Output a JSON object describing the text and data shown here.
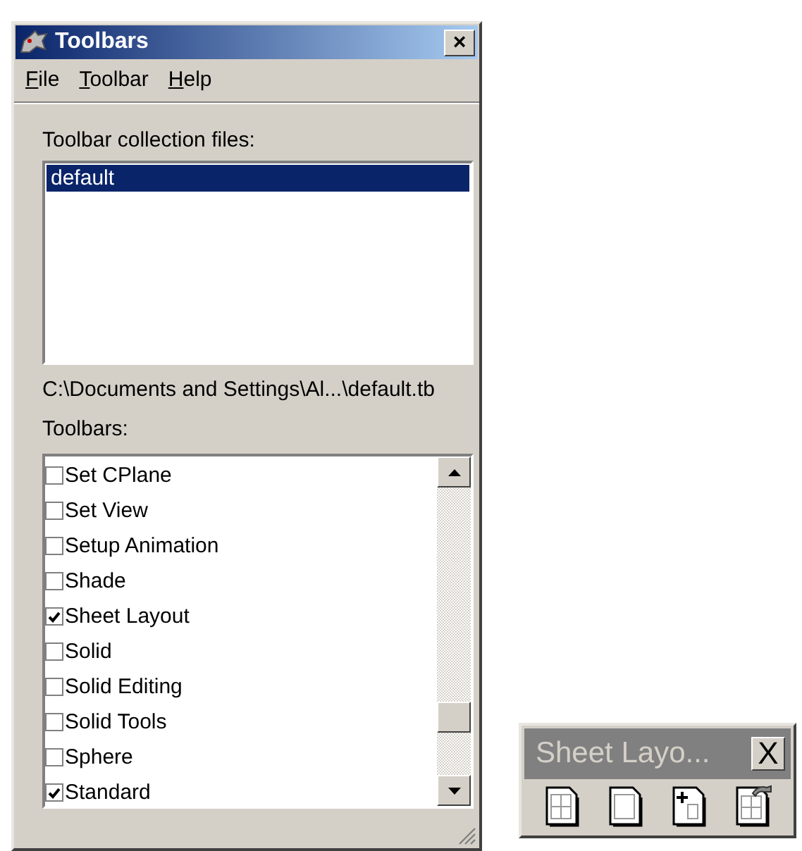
{
  "window": {
    "title": "Toolbars",
    "close": "×"
  },
  "menu": [
    {
      "label": "File"
    },
    {
      "label": "Toolbar"
    },
    {
      "label": "Help"
    }
  ],
  "collection_label": "Toolbar collection files:",
  "collection_files": [
    {
      "label": "default",
      "selected": true
    }
  ],
  "path": "C:\\Documents and Settings\\Al...\\default.tb",
  "toolbars_label": "Toolbars:",
  "toolbars": [
    {
      "label": "Set CPlane",
      "checked": false
    },
    {
      "label": "Set View",
      "checked": false
    },
    {
      "label": "Setup Animation",
      "checked": false
    },
    {
      "label": "Shade",
      "checked": false
    },
    {
      "label": "Sheet Layout",
      "checked": true
    },
    {
      "label": "Solid",
      "checked": false
    },
    {
      "label": "Solid Editing",
      "checked": false
    },
    {
      "label": "Solid Tools",
      "checked": false
    },
    {
      "label": "Sphere",
      "checked": false
    },
    {
      "label": "Standard",
      "checked": true
    }
  ],
  "floating_toolbar": {
    "title": "Sheet Layo...",
    "close": "X",
    "buttons": [
      {
        "kind": "grid"
      },
      {
        "kind": "blank"
      },
      {
        "kind": "add"
      },
      {
        "kind": "grid-import"
      }
    ]
  }
}
